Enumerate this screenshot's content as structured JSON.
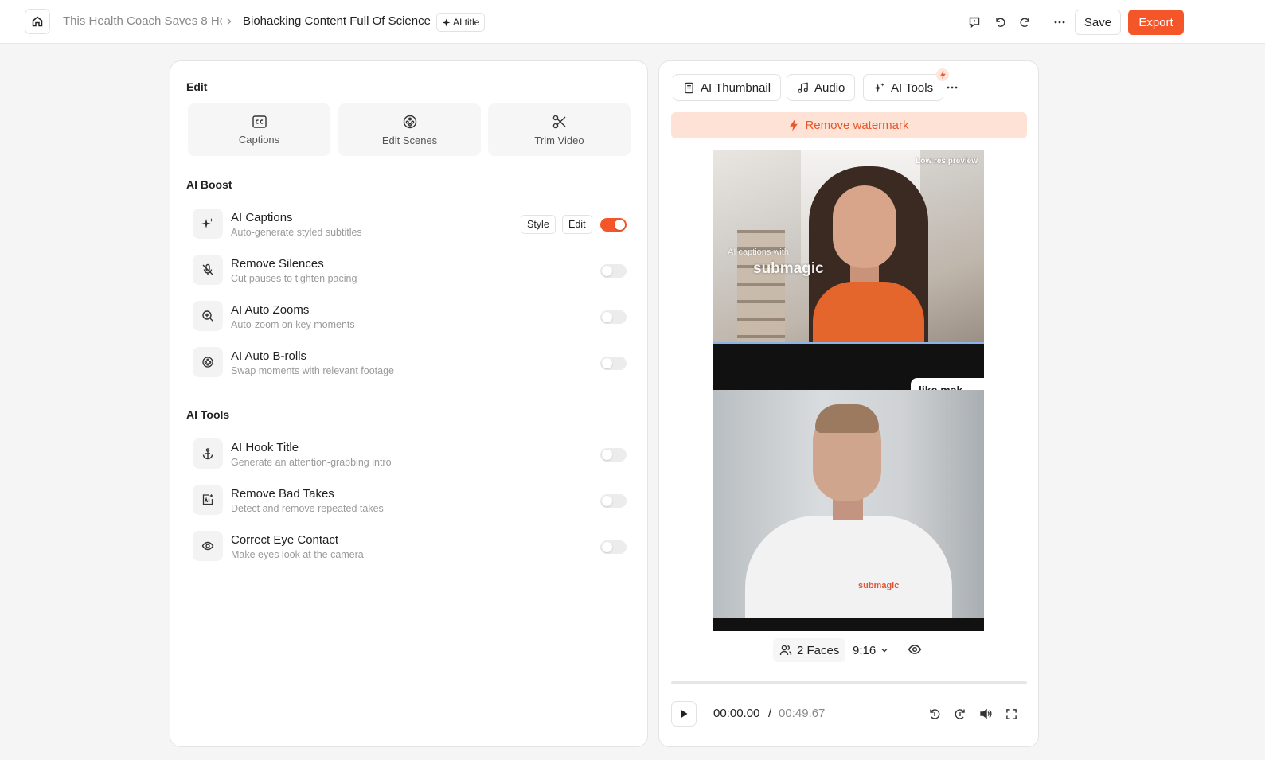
{
  "header": {
    "breadcrumb_project": "This Health Coach Saves 8 Hc",
    "breadcrumb_title": "Biohacking Content Full Of Science",
    "ai_title_label": "AI title",
    "save_label": "Save",
    "export_label": "Export",
    "icons": [
      "home-icon",
      "chevron-right-icon",
      "sparkle-icon",
      "feedback-icon",
      "undo-icon",
      "redo-icon",
      "more-icon"
    ]
  },
  "left": {
    "edit_title": "Edit",
    "edit_cards": [
      {
        "label": "Captions",
        "icon": "cc-icon"
      },
      {
        "label": "Edit Scenes",
        "icon": "film-reel-icon"
      },
      {
        "label": "Trim Video",
        "icon": "scissors-icon"
      }
    ],
    "ai_boost_title": "AI Boost",
    "ai_boost": [
      {
        "title": "AI Captions",
        "subtitle": "Auto-generate styled subtitles",
        "enabled": true,
        "icon": "sparkles-icon",
        "style_label": "Style",
        "edit_label": "Edit"
      },
      {
        "title": "Remove Silences",
        "subtitle": "Cut pauses to tighten pacing",
        "enabled": false,
        "icon": "mic-off-icon"
      },
      {
        "title": "AI Auto Zooms",
        "subtitle": "Auto-zoom on key moments",
        "enabled": false,
        "icon": "zoom-in-icon"
      },
      {
        "title": "AI Auto B-rolls",
        "subtitle": "Swap moments with relevant footage",
        "enabled": false,
        "icon": "film-reel-icon"
      }
    ],
    "ai_tools_title": "AI Tools",
    "ai_tools": [
      {
        "title": "AI Hook Title",
        "subtitle": "Generate an attention-grabbing intro",
        "enabled": false,
        "icon": "anchor-icon"
      },
      {
        "title": "Remove Bad Takes",
        "subtitle": "Detect and remove repeated takes",
        "enabled": false,
        "icon": "ai-image-icon"
      },
      {
        "title": "Correct Eye Contact",
        "subtitle": "Make eyes look at the camera",
        "enabled": false,
        "icon": "eye-icon"
      }
    ]
  },
  "right": {
    "tabs": [
      {
        "label": "AI Thumbnail",
        "icon": "thumbnail-icon"
      },
      {
        "label": "Audio",
        "icon": "music-note-icon"
      },
      {
        "label": "AI Tools",
        "icon": "sparkles-icon"
      }
    ],
    "remove_watermark_label": "Remove watermark",
    "preview": {
      "low_res_label": "Low res preview",
      "overlay_small": "AI captions with",
      "overlay_big": "submagic",
      "caption_chip": "like mak",
      "shirt_logo": "submagic"
    },
    "faces_label": "2 Faces",
    "aspect_ratio": "9:16",
    "playback": {
      "current_time": "00:00.00",
      "separator": "/",
      "total_time": "00:49.67",
      "progress": 0
    },
    "accent_color": "#f4562a"
  }
}
